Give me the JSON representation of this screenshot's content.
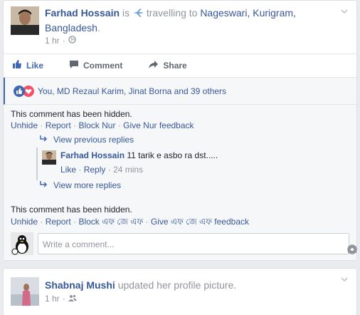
{
  "post1": {
    "author": "Farhad Hossain",
    "is_text": "is",
    "activity": "travelling to",
    "location": "Nageswari, Kurigram, Bangladesh",
    "period": ".",
    "time": "1 hr",
    "dot": "·",
    "actions": {
      "like": "Like",
      "comment": "Comment",
      "share": "Share"
    },
    "reactions_text": "You, MD Rezaul Karim, Jinat Borna and 39 others",
    "hidden1": {
      "text": "This comment has been hidden.",
      "unhide": "Unhide",
      "report": "Report",
      "block": "Block Nur",
      "feedback": "Give Nur feedback"
    },
    "view_previous": "View previous replies",
    "reply": {
      "author": "Farhad Hossain",
      "text": "11 tarik e asbo ra dst.....",
      "like": "Like",
      "reply": "Reply",
      "time": "24 mins"
    },
    "view_more": "View more replies",
    "hidden2": {
      "text": "This comment has been hidden.",
      "unhide": "Unhide",
      "report": "Report",
      "block": "Block এফ জে এফ",
      "feedback": "Give এফ জে এফ feedback"
    },
    "write_placeholder": "Write a comment...",
    "sep": "·"
  },
  "post2": {
    "author": "Shabnaj Mushi",
    "activity": "updated her profile picture.",
    "time": "1 hr",
    "dot": "·"
  },
  "colors": {
    "link": "#365899",
    "accent": "#4267b2",
    "muted": "#90949c",
    "love": "#f25268"
  }
}
